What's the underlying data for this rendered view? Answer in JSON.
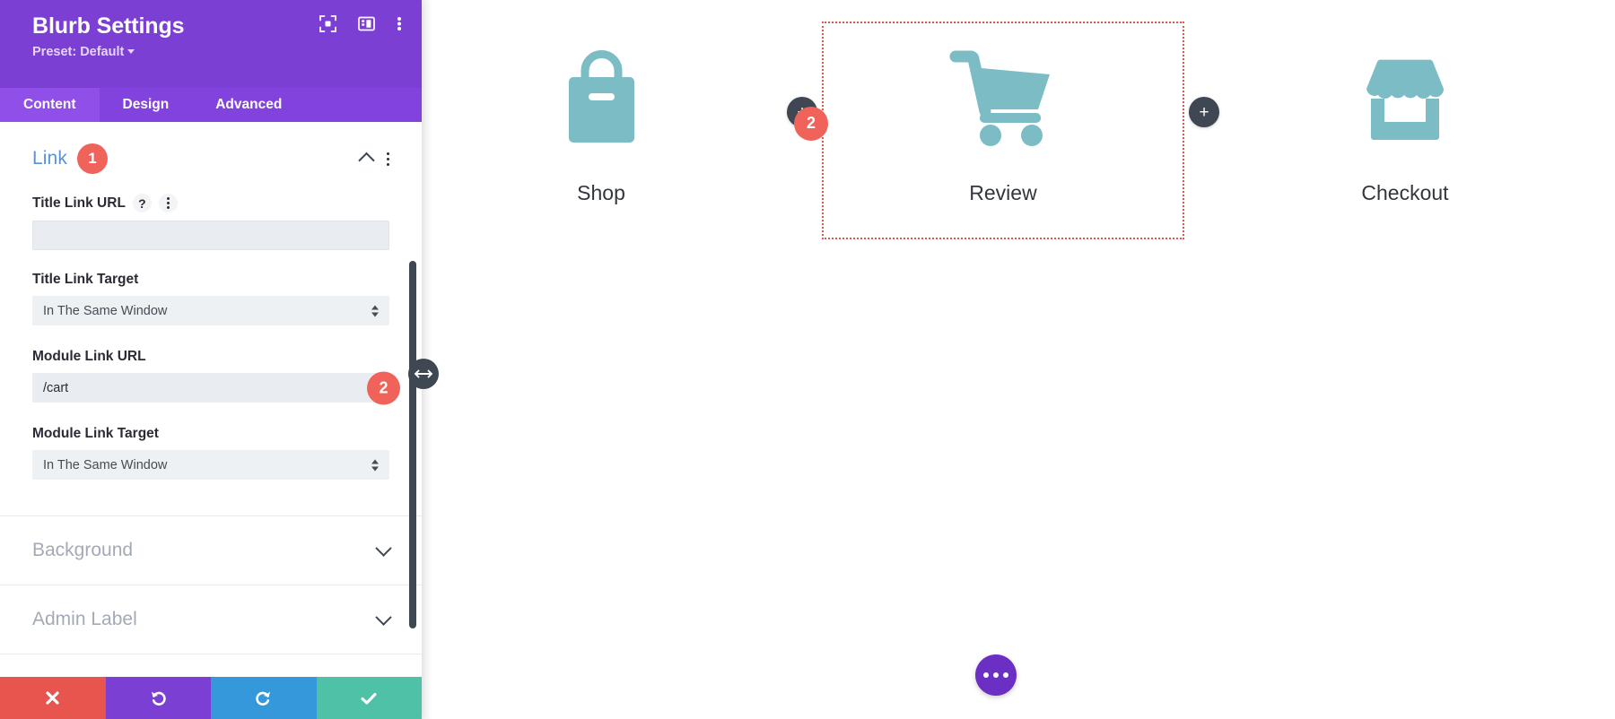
{
  "panel": {
    "title": "Blurb Settings",
    "preset_label": "Preset: Default",
    "header_icons": [
      {
        "name": "focus-icon",
        "label": "focus"
      },
      {
        "name": "layout-panel-icon",
        "label": "layout"
      },
      {
        "name": "more-vertical-icon",
        "label": "more"
      }
    ],
    "tabs": [
      {
        "label": "Content",
        "active": true
      },
      {
        "label": "Design",
        "active": false
      },
      {
        "label": "Advanced",
        "active": false
      }
    ],
    "sections": {
      "link": {
        "title": "Link",
        "badge": "1",
        "expanded": true,
        "fields": {
          "title_link_url": {
            "label": "Title Link URL",
            "value": "",
            "placeholder": ""
          },
          "title_link_target": {
            "label": "Title Link Target",
            "value": "In The Same Window"
          },
          "module_link_url": {
            "label": "Module Link URL",
            "value": "/cart",
            "badge": "2"
          },
          "module_link_target": {
            "label": "Module Link Target",
            "value": "In The Same Window"
          }
        }
      },
      "background": {
        "title": "Background",
        "expanded": false
      },
      "admin_label": {
        "title": "Admin Label",
        "expanded": false
      }
    },
    "footer_buttons": [
      {
        "name": "cancel-button",
        "icon": "close-icon",
        "color": "#e8554e"
      },
      {
        "name": "undo-button",
        "icon": "undo-icon",
        "color": "#7b3fd3"
      },
      {
        "name": "redo-button",
        "icon": "redo-icon",
        "color": "#3498db"
      },
      {
        "name": "save-button",
        "icon": "check-icon",
        "color": "#4fc1a6"
      }
    ]
  },
  "canvas": {
    "modules": [
      {
        "title": "Shop",
        "icon": "shopping-bag-icon",
        "selected": false
      },
      {
        "title": "Review",
        "icon": "shopping-cart-icon",
        "selected": true,
        "badge": "2"
      },
      {
        "title": "Checkout",
        "icon": "storefront-icon",
        "selected": false
      }
    ],
    "add_button_label": "+",
    "fab_label": "•••"
  },
  "colors": {
    "brand_purple": "#7b3fd3",
    "tab_purple": "#8142dd",
    "accent_red": "#f0635a",
    "icon_teal": "#7cbcc4",
    "dark_slate": "#3e4752"
  }
}
